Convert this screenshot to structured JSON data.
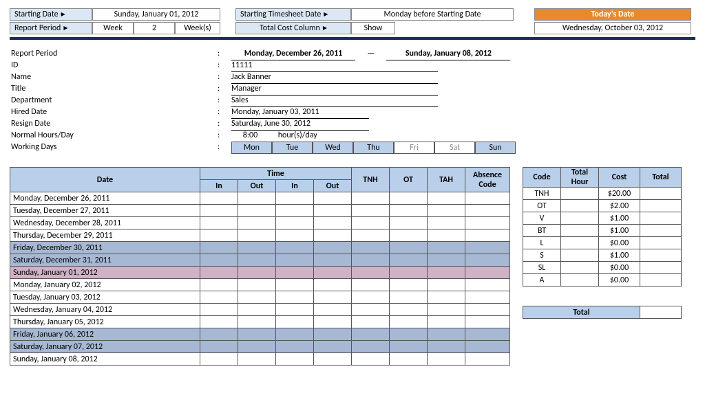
{
  "top": {
    "startDateLabel": "Starting Date",
    "startDateValue": "Sunday, January 01, 2012",
    "startTimesheetLabel": "Starting Timesheet Date",
    "startTimesheetValue": "Monday before Starting Date",
    "reportPeriodLabel": "Report Period",
    "weekLabel": "Week",
    "weekValue": "2",
    "weeksSuffix": "Week(s)",
    "totalCostLabel": "Total Cost Column",
    "totalCostValue": "Show",
    "todayLabel": "Today's Date",
    "todayValue": "Wednesday, October 03, 2012"
  },
  "info": {
    "reportPeriodLabel": "Report Period",
    "reportStart": "Monday, December 26, 2011",
    "dash": "—",
    "reportEnd": "Sunday, January 08, 2012",
    "idLabel": "ID",
    "idValue": "11111",
    "nameLabel": "Name",
    "nameValue": "Jack Banner",
    "titleLabel": "Title",
    "titleValue": "Manager",
    "deptLabel": "Department",
    "deptValue": "Sales",
    "hiredLabel": "Hired Date",
    "hiredValue": "Monday, January 03, 2011",
    "resignLabel": "Resign Date",
    "resignValue": "Saturday, June 30, 2012",
    "normalLabel": "Normal Hours/Day",
    "normalValue": "8:00",
    "normalSuffix": "hour(s)/day",
    "wdLabel": "Working Days",
    "wd": [
      {
        "d": "Mon",
        "on": true
      },
      {
        "d": "Tue",
        "on": true
      },
      {
        "d": "Wed",
        "on": true
      },
      {
        "d": "Thu",
        "on": true
      },
      {
        "d": "Fri",
        "on": false
      },
      {
        "d": "Sat",
        "on": false
      },
      {
        "d": "Sun",
        "on": true
      }
    ]
  },
  "tsHeaders": {
    "date": "Date",
    "time": "Time",
    "in": "In",
    "out": "Out",
    "tnh": "TNH",
    "ot": "OT",
    "tah": "TAH",
    "abs": "Absence Code"
  },
  "tsRows": [
    {
      "date": "Monday, December 26, 2011",
      "cls": ""
    },
    {
      "date": "Tuesday, December 27, 2011",
      "cls": ""
    },
    {
      "date": "Wednesday, December 28, 2011",
      "cls": ""
    },
    {
      "date": "Thursday, December 29, 2011",
      "cls": ""
    },
    {
      "date": "Friday, December 30, 2011",
      "cls": "weekend"
    },
    {
      "date": "Saturday, December 31, 2011",
      "cls": "weekend"
    },
    {
      "date": "Sunday, January 01, 2012",
      "cls": "sunday"
    },
    {
      "date": "Monday, January 02, 2012",
      "cls": ""
    },
    {
      "date": "Tuesday, January 03, 2012",
      "cls": ""
    },
    {
      "date": "Wednesday, January 04, 2012",
      "cls": ""
    },
    {
      "date": "Thursday, January 05, 2012",
      "cls": ""
    },
    {
      "date": "Friday, January 06, 2012",
      "cls": "weekend"
    },
    {
      "date": "Saturday, January 07, 2012",
      "cls": "weekend"
    },
    {
      "date": "Sunday, January 08, 2012",
      "cls": ""
    }
  ],
  "codesHeaders": {
    "code": "Code",
    "hour": "Total Hour",
    "cost": "Cost",
    "total": "Total"
  },
  "codes": [
    {
      "code": "TNH",
      "hour": "",
      "cost": "$20.00",
      "total": ""
    },
    {
      "code": "OT",
      "hour": "",
      "cost": "$2.00",
      "total": ""
    },
    {
      "code": "V",
      "hour": "",
      "cost": "$1.00",
      "total": ""
    },
    {
      "code": "BT",
      "hour": "",
      "cost": "$1.00",
      "total": ""
    },
    {
      "code": "L",
      "hour": "",
      "cost": "$0.00",
      "total": ""
    },
    {
      "code": "S",
      "hour": "",
      "cost": "$1.00",
      "total": ""
    },
    {
      "code": "SL",
      "hour": "",
      "cost": "$0.00",
      "total": ""
    },
    {
      "code": "A",
      "hour": "",
      "cost": "$0.00",
      "total": ""
    }
  ],
  "codesTotalLabel": "Total"
}
